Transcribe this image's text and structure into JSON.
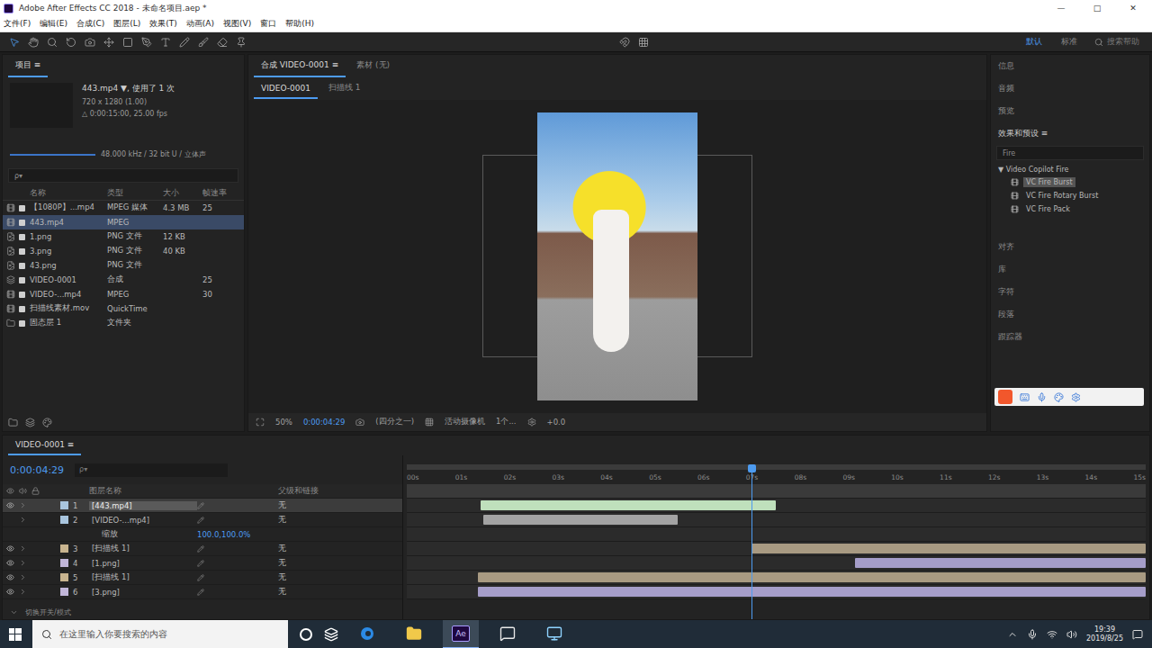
{
  "window": {
    "title": "Adobe After Effects CC 2018 - 未命名项目.aep *",
    "controls": [
      "—",
      "□",
      "✕"
    ]
  },
  "menu": [
    "文件(F)",
    "编辑(E)",
    "合成(C)",
    "图层(L)",
    "效果(T)",
    "动画(A)",
    "视图(V)",
    "窗口",
    "帮助(H)"
  ],
  "toolbar": {
    "workspaces": [
      {
        "label": "默认",
        "selected": true
      },
      {
        "label": "标准",
        "selected": false
      }
    ],
    "search": "搜索帮助"
  },
  "project": {
    "title": "项目 ≡",
    "footage": "443.mp4 ▼",
    "usage": ", 使用了 1 次",
    "info": [
      "720 x 1280 (1.00)",
      "△ 0:00:15:00, 25.00 fps"
    ],
    "audio": "48.000 kHz / 32 bit U / 立体声",
    "search": "ρ▾",
    "columns": [
      "名称",
      "类型",
      "大小",
      "帧速率"
    ],
    "items": [
      {
        "name": "【1080P】...mp4",
        "kind": "footage",
        "type": "MPEG 媒体",
        "size": "4.3 MB",
        "fps": "25",
        "selected": false
      },
      {
        "name": "443.mp4",
        "kind": "footage",
        "type": "MPEG",
        "size": "",
        "fps": "",
        "selected": true
      },
      {
        "name": "1.png",
        "kind": "image",
        "type": "PNG 文件",
        "size": "12 KB",
        "fps": "",
        "selected": false
      },
      {
        "name": "3.png",
        "kind": "image",
        "type": "PNG 文件",
        "size": "40 KB",
        "fps": "",
        "selected": false
      },
      {
        "name": "43.png",
        "kind": "image",
        "type": "PNG 文件",
        "size": "",
        "fps": "",
        "selected": false
      },
      {
        "name": "VIDEO-0001",
        "kind": "comp",
        "type": "合成",
        "size": "",
        "fps": "25",
        "selected": false
      },
      {
        "name": "VIDEO-...mp4",
        "kind": "footage",
        "type": "MPEG",
        "size": "",
        "fps": "30",
        "selected": false
      },
      {
        "name": "扫描线素材.mov",
        "kind": "footage",
        "type": "QuickTime",
        "size": "",
        "fps": "",
        "selected": false
      },
      {
        "name": "固态层 1",
        "kind": "folder",
        "type": "文件夹",
        "size": "",
        "fps": "",
        "selected": false
      }
    ]
  },
  "viewer": {
    "tabs": [
      {
        "label": "合成 VIDEO-0001 ≡",
        "selected": true
      },
      {
        "label": "素材 (无)",
        "selected": false
      }
    ],
    "breadcrumbs": [
      {
        "label": "VIDEO-0001",
        "selected": true
      },
      {
        "label": "扫描线 1",
        "selected": false
      }
    ],
    "controls": {
      "zoom": "50%",
      "time": "0:00:04:29",
      "resolution": "(四分之一)",
      "camera": "活动摄像机",
      "views": "1个...",
      "exposure": "+0.0"
    }
  },
  "right": {
    "top": [
      "信息",
      "音频",
      "预览"
    ],
    "effects": {
      "title": "效果和预设 ≡",
      "search": "Fire",
      "group": "▼ Video Copilot Fire",
      "items": [
        {
          "label": "VC Fire Burst",
          "selected": true
        },
        {
          "label": "VC Fire Rotary Burst",
          "selected": false
        },
        {
          "label": "VC Fire Pack",
          "selected": false
        }
      ]
    },
    "bottom": [
      "对齐",
      "库",
      "字符",
      "段落",
      "跟踪器"
    ]
  },
  "timeline": {
    "tab": "VIDEO-0001 ≡",
    "time": "0:00:04:29",
    "search": "ρ▾",
    "columns": [
      "图层名称",
      "父级和链接"
    ],
    "parent": "无",
    "ruler": [
      "00s",
      "01s",
      "02s",
      "03s",
      "04s",
      "05s",
      "06s",
      "07s",
      "08s",
      "09s",
      "10s",
      "11s",
      "12s",
      "13s",
      "14s",
      "15s"
    ],
    "playhead": {
      "level": 0.467
    },
    "layers": [
      {
        "num": "1",
        "name": "[443.mp4]",
        "kind": "layer",
        "selected": true,
        "visible": true,
        "in": 1.5,
        "out": 7.5,
        "color": "#bfe0bc",
        "label": "#a9c5de"
      },
      {
        "num": "2",
        "name": "[VIDEO-...mp4]",
        "kind": "layer",
        "selected": false,
        "visible": false,
        "in": 1.55,
        "out": 5.5,
        "color": "#a3a3a3",
        "label": "#a9c5de"
      },
      {
        "num": "",
        "name": "缩放",
        "kind": "property",
        "value": "100.0,100.0%"
      },
      {
        "num": "3",
        "name": "[扫描线 1]",
        "kind": "layer",
        "selected": false,
        "visible": true,
        "in": 7.0,
        "out": 15,
        "color": "#a89a82",
        "label": "#c8b48f"
      },
      {
        "num": "4",
        "name": "[1.png]",
        "kind": "layer",
        "selected": false,
        "visible": true,
        "in": 9.1,
        "out": 15,
        "color": "#a59dc9",
        "label": "#c1b6d8"
      },
      {
        "num": "5",
        "name": "[扫描线 1]",
        "kind": "layer",
        "selected": false,
        "visible": true,
        "in": 1.45,
        "out": 15,
        "color": "#a89a82",
        "label": "#c8b48f"
      },
      {
        "num": "6",
        "name": "[3.png]",
        "kind": "layer",
        "selected": false,
        "visible": true,
        "in": 1.45,
        "out": 15,
        "color": "#a59dc9",
        "label": "#c1b6d8"
      }
    ],
    "footer": "切换开关/模式"
  },
  "taskbar": {
    "search": "在这里输入你要搜索的内容",
    "apps": [
      {
        "kind": "edge",
        "selected": false
      },
      {
        "kind": "folder",
        "selected": false
      },
      {
        "kind": "ae",
        "selected": true,
        "label": "Ae"
      },
      {
        "kind": "note",
        "selected": false
      },
      {
        "kind": "app",
        "selected": false
      }
    ],
    "time": "19:39",
    "date": "2019/8/25"
  }
}
